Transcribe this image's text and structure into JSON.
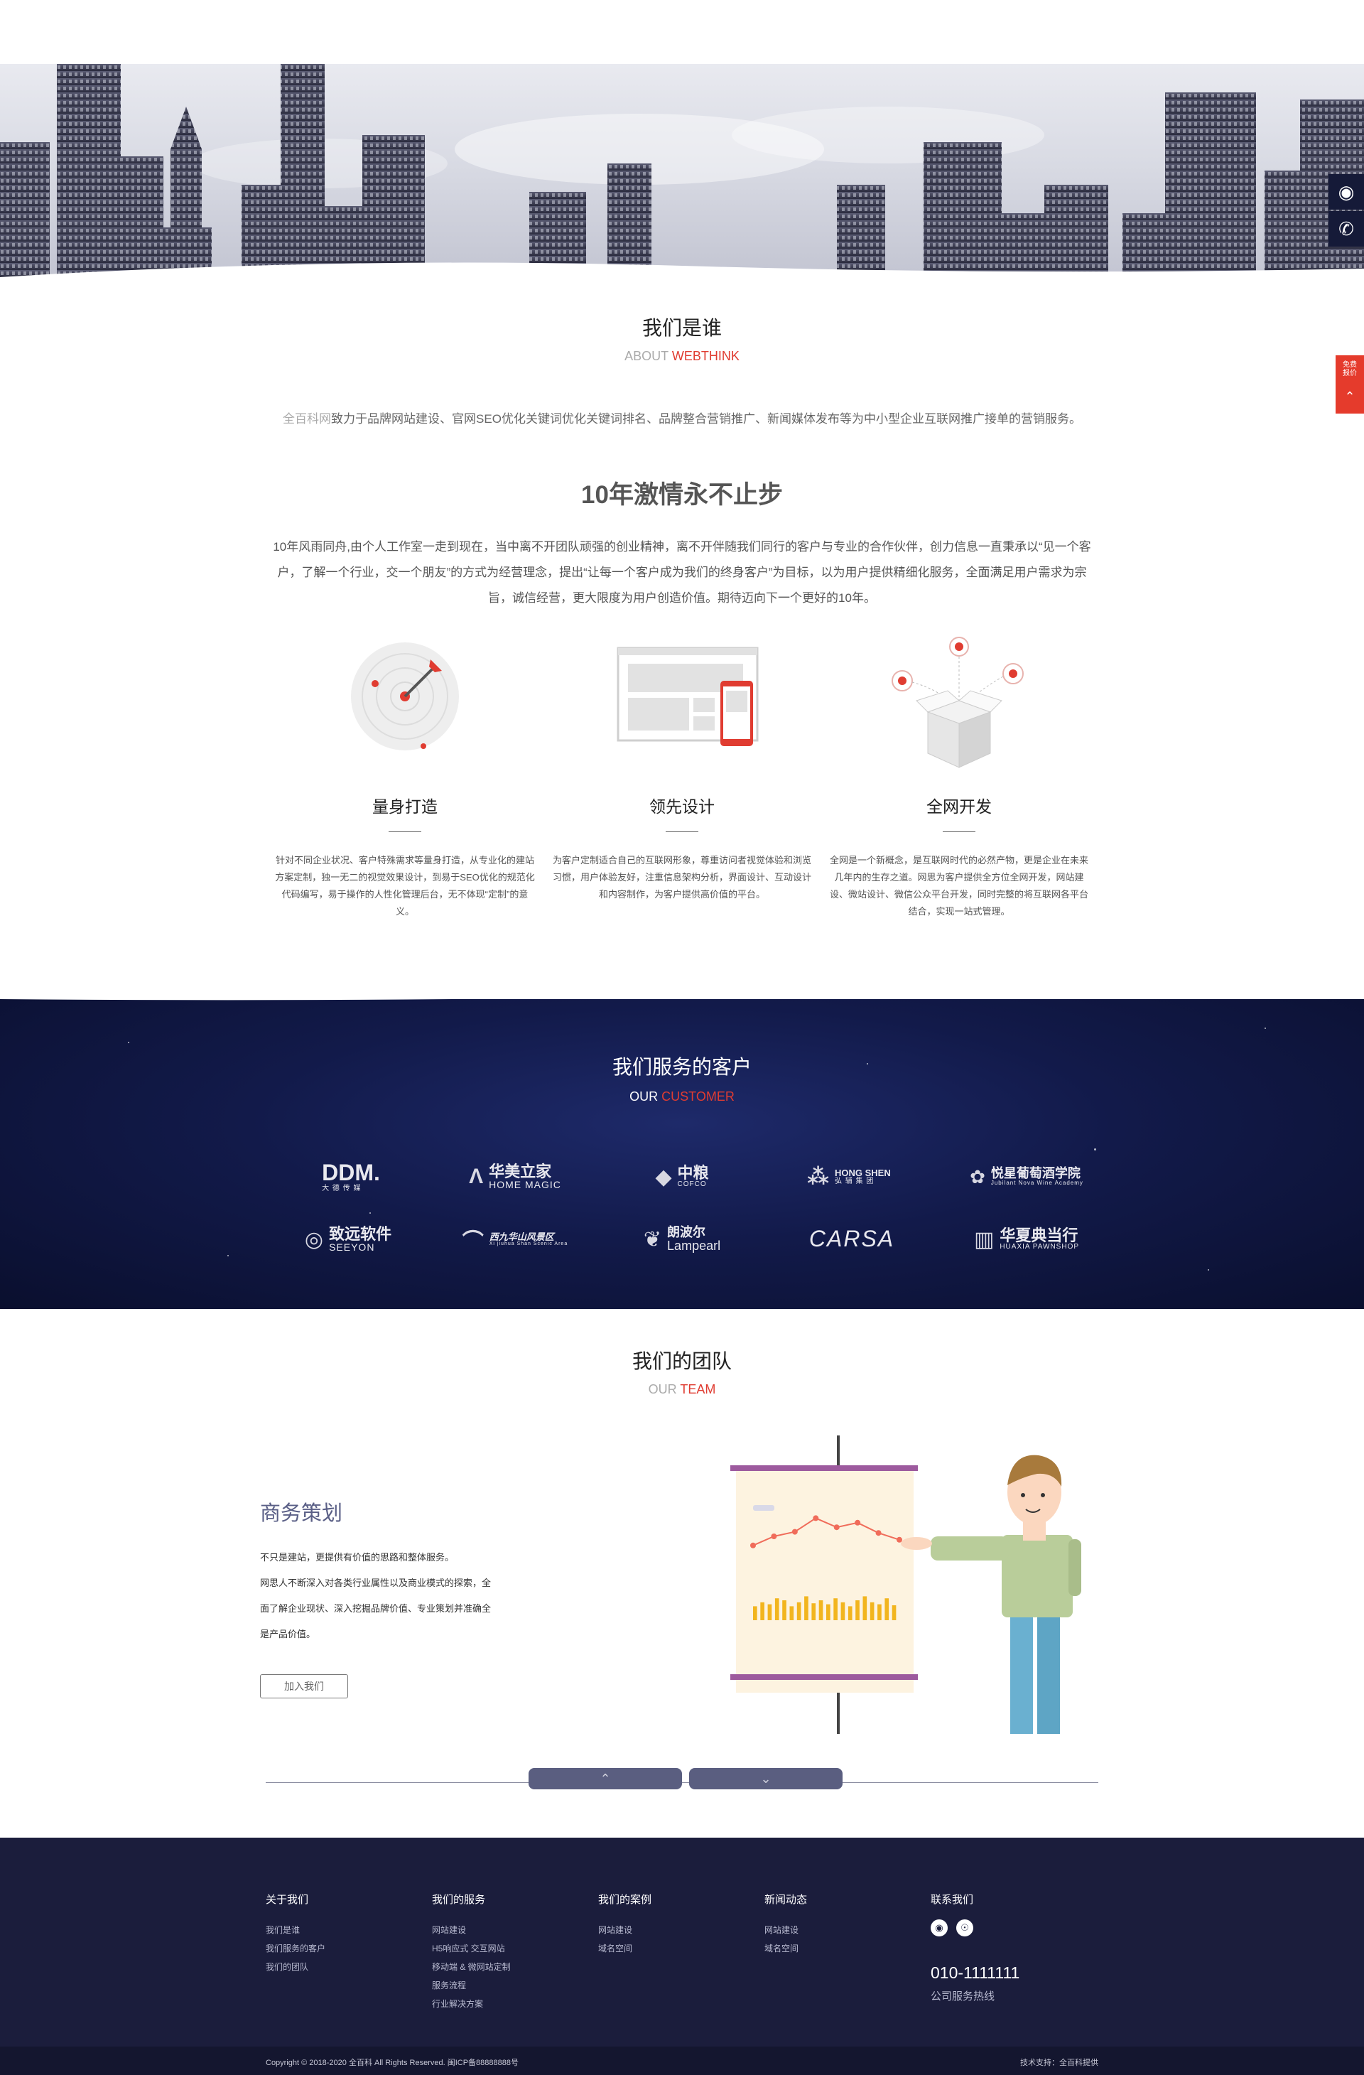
{
  "about": {
    "title": "我们是谁",
    "sub_prefix": "ABOUT ",
    "sub_accent": "WEBTHINK",
    "intro_brand": "全百科网",
    "intro_text": "致力于品牌网站建设、官网SEO优化关键词优化关键词排名、品牌整合营销推广、新闻媒体发布等为中小型企业互联网推广接单的营销服务。",
    "slogan": "10年激情永不止步",
    "body": "10年风雨同舟,由个人工作室一走到现在，当中离不开团队顽强的创业精神，离不开伴随我们同行的客户与专业的合作伙伴，创力信息一直秉承以“见一个客户，了解一个行业，交一个朋友”的方式为经营理念，提出“让每一个客户成为我们的终身客户”为目标，以为用户提供精细化服务，全面满足用户需求为宗旨，诚信经营，更大限度为用户创造价值。期待迈向下一个更好的10年。",
    "features": [
      {
        "title": "量身打造",
        "desc": "针对不同企业状况、客户特殊需求等量身打造，从专业化的建站方案定制，独一无二的视觉效果设计，到易于SEO优化的规范化代码编写，易于操作的人性化管理后台，无不体现“定制”的意义。"
      },
      {
        "title": "领先设计",
        "desc": "为客户定制适合自己的互联网形象，尊重访问者视觉体验和浏览习惯，用户体验友好，注重信息架构分析，界面设计、互动设计和内容制作，为客户提供高价值的平台。"
      },
      {
        "title": "全网开发",
        "desc": "全网是一个新概念，是互联网时代的必然产物，更是企业在未来几年内的生存之道。网思为客户提供全方位全网开发，网站建设、微站设计、微信公众平台开发，同时完整的将互联网各平台结合，实现一站式管理。"
      }
    ]
  },
  "customers": {
    "title": "我们服务的客户",
    "sub_prefix": "OUR ",
    "sub_accent": "CUSTOMER",
    "logos": [
      {
        "mark": "",
        "main": "DDM.",
        "sub": "大 德 传 媒"
      },
      {
        "mark": "Λ",
        "main": "华美立家",
        "sub": "HOME MAGIC"
      },
      {
        "mark": "◆",
        "main": "中粮",
        "sub": "COFCO"
      },
      {
        "mark": "⁂",
        "main": "HONG SHEN",
        "sub": "弘 辅 集 团"
      },
      {
        "mark": "✿",
        "main": "悦星葡萄酒学院",
        "sub": "Jubilant Nova Wine Academy"
      },
      {
        "mark": "◎",
        "main": "致远软件",
        "sub": "SEEYON"
      },
      {
        "mark": "⌒",
        "main": "西九华山风景区",
        "sub": "Xi jiuhua Shan Scenic Area"
      },
      {
        "mark": "❦",
        "main": "朗波尔",
        "sub": "Lampearl"
      },
      {
        "mark": "",
        "main": "CARSA",
        "sub": ""
      },
      {
        "mark": "▥",
        "main": "华夏典当行",
        "sub": "HUAXIA PAWNSHOP"
      }
    ]
  },
  "team": {
    "title": "我们的团队",
    "sub_prefix": "OUR ",
    "sub_accent": "TEAM",
    "role": "商务策划",
    "desc": [
      "不只是建站，更提供有价值的思路和整体服务。",
      "网思人不断深入对各类行业属性以及商业模式的探索，全",
      "面了解企业现状、深入挖掘品牌价值、专业策划并准确全",
      "是产品价值。"
    ],
    "join_label": "加入我们",
    "chart_line": [
      22,
      30,
      34,
      46,
      38,
      42,
      33,
      27
    ],
    "chart_bars": [
      14,
      18,
      16,
      22,
      20,
      14,
      18,
      24,
      17,
      20,
      16,
      22,
      18,
      14,
      20,
      24,
      18,
      16,
      22,
      15
    ]
  },
  "footer": {
    "cols": [
      {
        "head": "关于我们",
        "items": [
          "我们是谁",
          "我们服务的客户",
          "我们的团队"
        ]
      },
      {
        "head": "我们的服务",
        "items": [
          "网站建设",
          "H5响应式 交互网站",
          "移动端 & 微网站定制",
          "服务流程",
          "行业解决方案"
        ]
      },
      {
        "head": "我们的案例",
        "items": [
          "网站建设",
          "域名空间"
        ]
      },
      {
        "head": "新闻动态",
        "items": [
          "网站建设",
          "域名空间"
        ]
      }
    ],
    "contact_head": "联系我们",
    "phone": "010-1111111",
    "phone_label": "公司服务热线",
    "copyright": "Copyright © 2018-2020 全百科 All Rights Reserved.   闽ICP备88888888号",
    "tech_support": "技术支持：全百科提供"
  },
  "side": {
    "red_tab_label": "免费报价"
  },
  "colors": {
    "accent": "#e03c31",
    "navy": "#1b1d3c",
    "team_purple": "#5a5e80"
  }
}
